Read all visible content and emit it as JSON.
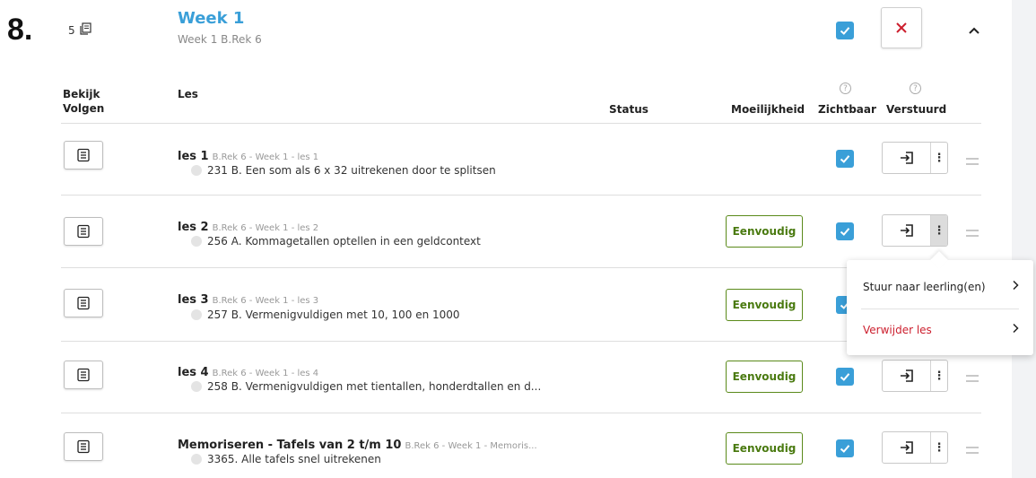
{
  "step_number": "8.",
  "lesson_count": "5",
  "week": {
    "title": "Week 1",
    "subtitle": "Week 1 B.Rek 6"
  },
  "headers": {
    "bekijk": "Bekijk",
    "volgen": "Volgen",
    "les": "Les",
    "status": "Status",
    "moeilijkheid": "Moeilijkheid",
    "zichtbaar": "Zichtbaar",
    "verstuurd": "Verstuurd"
  },
  "lessons": [
    {
      "name": "les 1",
      "crumb": "B.Rek 6 - Week 1 - les 1",
      "desc": "231 B. Een som als 6 x 32 uitrekenen door te splitsen",
      "difficulty": ""
    },
    {
      "name": "les 2",
      "crumb": "B.Rek 6 - Week 1 - les 2",
      "desc": "256 A. Kommagetallen optellen in een geldcontext",
      "difficulty": "Eenvoudig"
    },
    {
      "name": "les 3",
      "crumb": "B.Rek 6 - Week 1 - les 3",
      "desc": "257 B. Vermenigvuldigen met 10, 100 en 1000",
      "difficulty": "Eenvoudig"
    },
    {
      "name": "les 4",
      "crumb": "B.Rek 6 - Week 1 - les 4",
      "desc": "258 B. Vermenigvuldigen met tientallen, honderdtallen en d...",
      "difficulty": "Eenvoudig"
    },
    {
      "name": "Memoriseren - Tafels van 2 t/m 10",
      "crumb": "B.Rek 6 - Week 1 - Memoris...",
      "desc": "3365. Alle tafels snel uitrekenen",
      "difficulty": "Eenvoudig"
    }
  ],
  "menu": {
    "send_label": "Stuur naar leerling(en)",
    "delete_label": "Verwijder les"
  },
  "colors": {
    "accent": "#3a9fd8",
    "danger": "#cc1f2e",
    "badge": "#4a7a10"
  }
}
